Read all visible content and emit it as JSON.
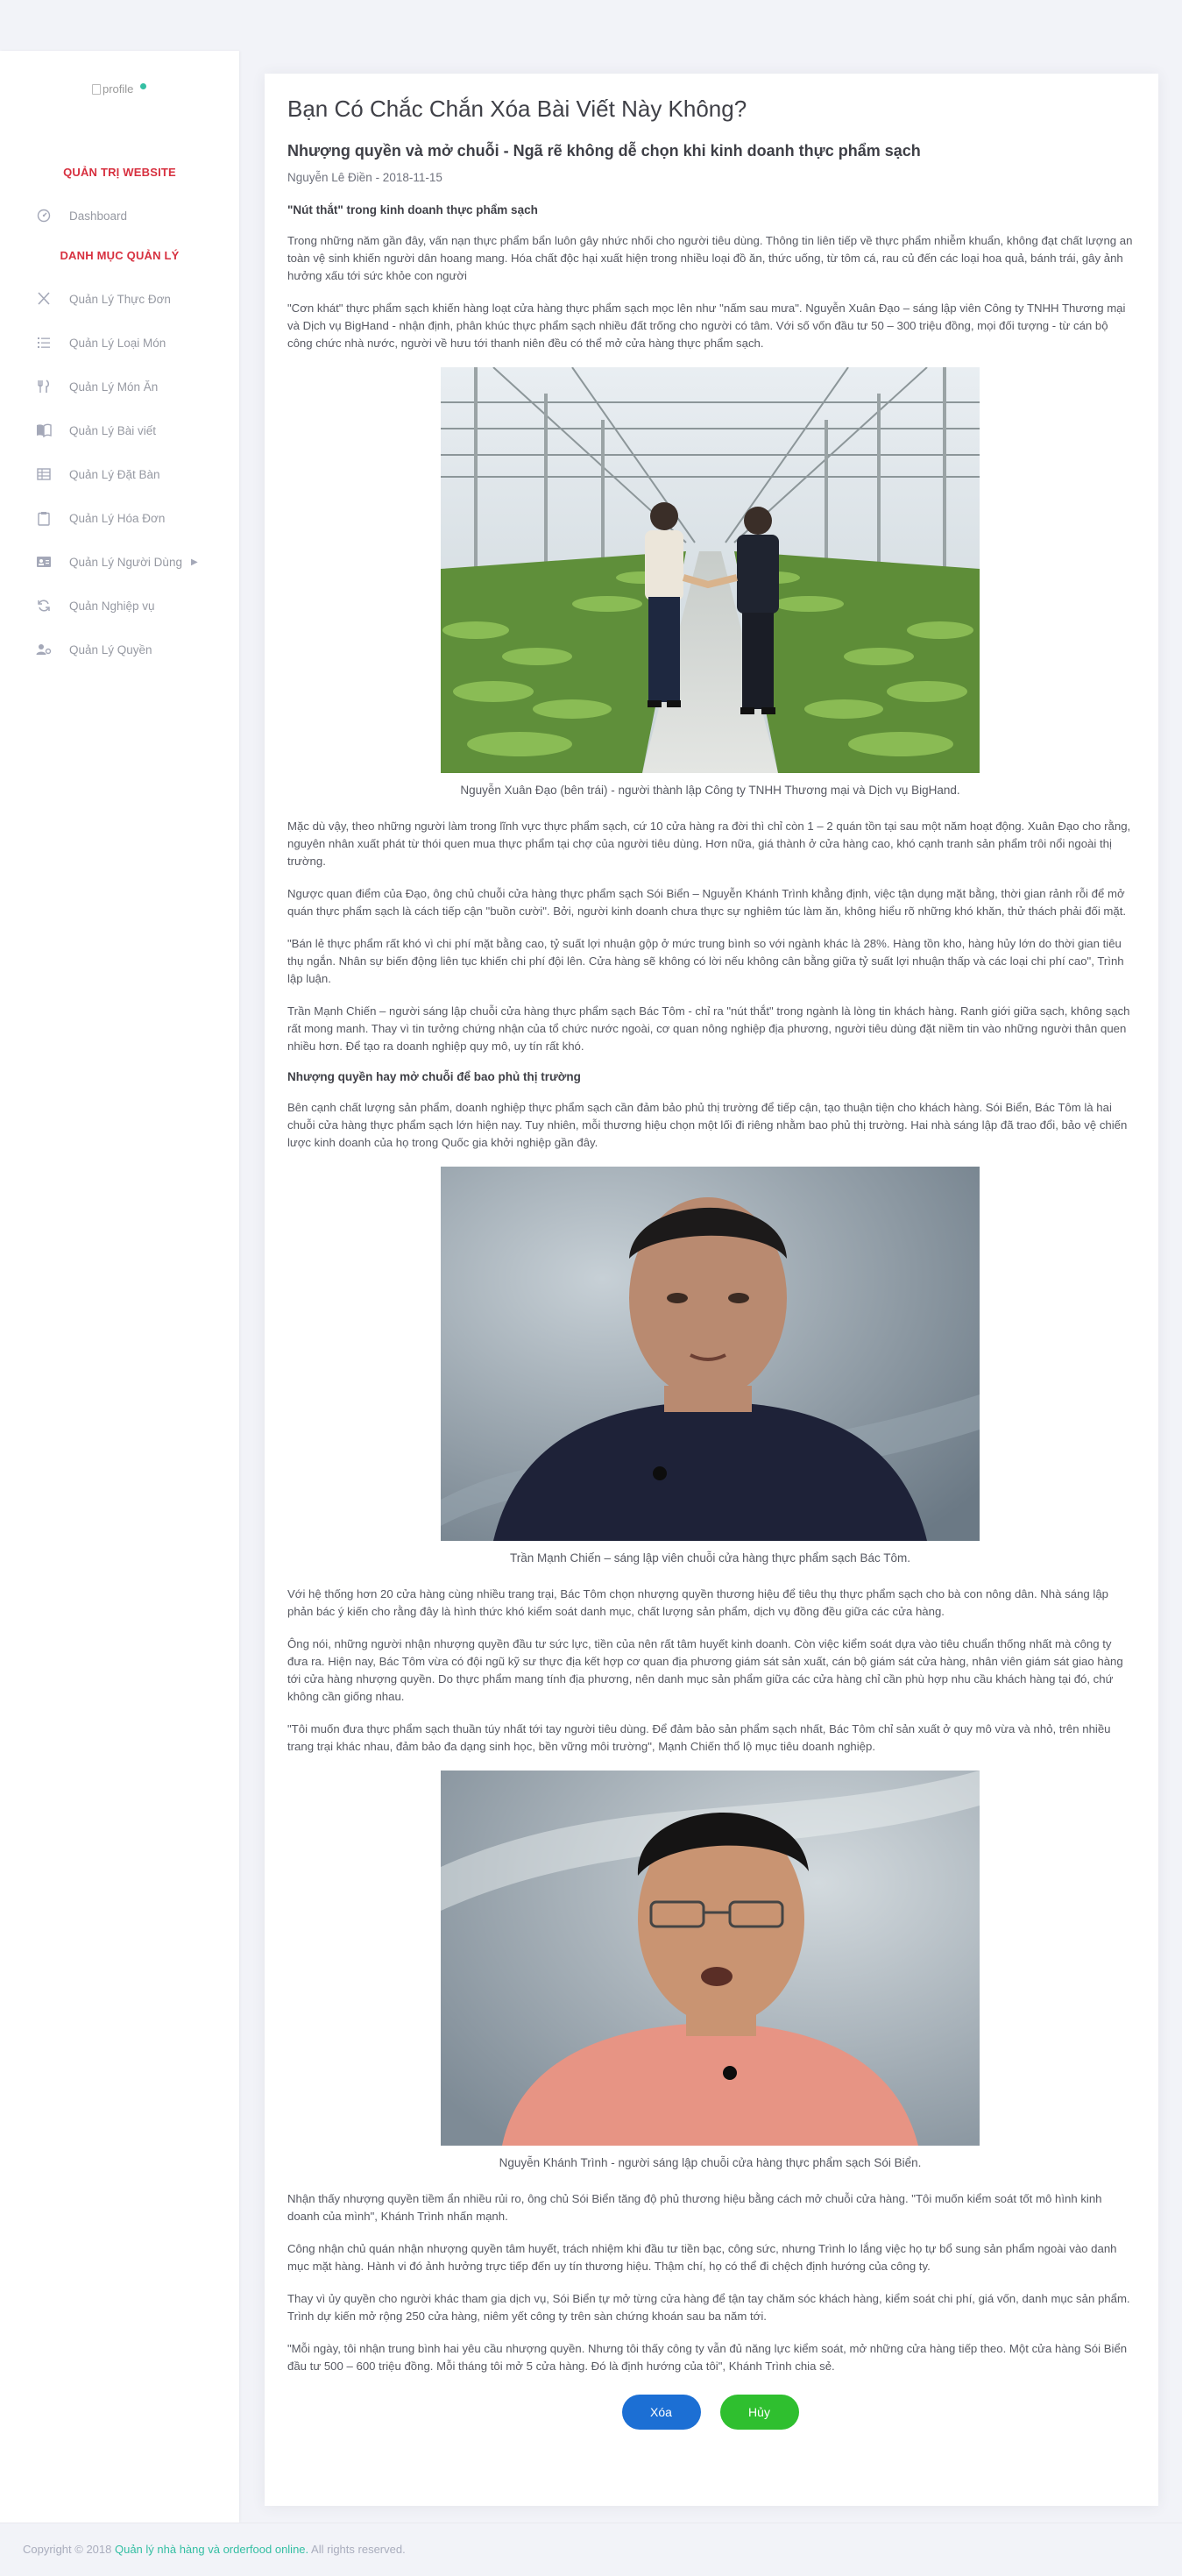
{
  "sidebar": {
    "avatar_alt": "profile",
    "section_admin": "QUẢN TRỊ WEBSITE",
    "dashboard": "Dashboard",
    "section_manage": "DANH MỤC QUẢN LÝ",
    "items": [
      {
        "label": "Quản Lý Thực Đơn",
        "icon": "utensils-icon"
      },
      {
        "label": "Quản Lý Loại Món",
        "icon": "list-icon"
      },
      {
        "label": "Quản Lý Món Ăn",
        "icon": "dish-icon"
      },
      {
        "label": "Quản Lý Bài viết",
        "icon": "book-icon"
      },
      {
        "label": "Quản Lý Đặt Bàn",
        "icon": "table-icon"
      },
      {
        "label": "Quản Lý Hóa Đơn",
        "icon": "clipboard-icon"
      },
      {
        "label": "Quản Lý Người Dùng",
        "icon": "id-card-icon"
      },
      {
        "label": "Quản Nghiệp vụ",
        "icon": "refresh-icon"
      },
      {
        "label": "Quản Lý Quyền",
        "icon": "user-cog-icon"
      }
    ]
  },
  "main": {
    "page_title": "Bạn Có Chắc Chắn Xóa Bài Viết Này Không?",
    "post_title": "Nhượng quyền và mở chuỗi - Ngã rẽ không dễ chọn khi kinh doanh thực phẩm sạch",
    "meta": "Nguyễn Lê Điền - 2018-11-15",
    "subhead1": "\"Nút thắt\" trong kinh doanh thực phẩm sạch",
    "p1": "Trong những năm gần đây, vấn nạn thực phẩm bẩn luôn gây nhức nhối cho người tiêu dùng. Thông tin liên tiếp về thực phẩm nhiễm khuẩn, không đạt chất lượng an toàn vệ sinh khiến người dân hoang mang. Hóa chất độc hại xuất hiện trong nhiều loại đồ ăn, thức uống, từ tôm cá, rau củ đến các loại hoa quả, bánh trái, gây ảnh hưởng xấu tới sức khỏe con người",
    "p2": "\"Cơn khát\" thực phẩm sạch khiến hàng loạt cửa hàng thực phẩm sạch mọc lên như \"nấm sau mưa\". Nguyễn Xuân Đạo – sáng lập viên Công ty TNHH Thương mại và Dịch vụ BigHand - nhận định, phân khúc thực phẩm sạch nhiều đất trống cho người có tâm. Với số vốn đầu tư 50 – 300 triệu đồng, mọi đối tượng - từ cán bộ công chức nhà nước, người về hưu tới thanh niên đều có thể mở cửa hàng thực phẩm sạch.",
    "caption1": "Nguyễn Xuân Đạo (bên trái) - người thành lập Công ty TNHH Thương mại và Dịch vụ BigHand.",
    "p3": "Mặc dù vậy, theo những người làm trong lĩnh vực thực phẩm sạch, cứ 10 cửa hàng ra đời thì chỉ còn 1 – 2 quán tồn tại sau một năm hoạt động. Xuân Đạo cho rằng, nguyên nhân xuất phát từ thói quen mua thực phẩm tại chợ của người tiêu dùng. Hơn nữa, giá thành ở cửa hàng cao, khó cạnh tranh sản phẩm trôi nổi ngoài thị trường.",
    "p4": "Ngược quan điểm của Đạo, ông chủ chuỗi cửa hàng thực phẩm sạch Sói Biển – Nguyễn Khánh Trình khẳng định, việc tận dụng mặt bằng, thời gian rảnh rỗi để mở quán thực phẩm sạch là cách tiếp cận \"buồn cười\". Bởi, người kinh doanh chưa thực sự nghiêm túc làm ăn, không hiểu rõ những khó khăn, thử thách phải đối mặt.",
    "p5": "\"Bán lẻ thực phẩm rất khó vì chi phí mặt bằng cao, tỷ suất lợi nhuận gộp ở mức trung bình so với ngành khác là 28%. Hàng tồn kho, hàng hủy lớn do thời gian tiêu thụ ngắn. Nhân sự biến động liên tục khiến chi phí đội lên. Cửa hàng sẽ không có lời nếu không cân bằng giữa tỷ suất lợi nhuận thấp và các loại chi phí cao\", Trình lập luận.",
    "p6": "Trần Mạnh Chiến – người sáng lập chuỗi cửa hàng thực phẩm sạch Bác Tôm - chỉ ra \"nút thắt\" trong ngành là lòng tin khách hàng. Ranh giới giữa sạch, không sạch rất mong manh. Thay vì tin tưởng chứng nhận của tổ chức nước ngoài, cơ quan nông nghiệp địa phương, người tiêu dùng đặt niềm tin vào những người thân quen nhiều hơn. Để tạo ra doanh nghiệp quy mô, uy tín rất khó.",
    "subhead2": "Nhượng quyền hay mở chuỗi để bao phủ thị trường",
    "p7": "Bên cạnh chất lượng sản phẩm, doanh nghiệp thực phẩm sạch cần đảm bảo phủ thị trường để tiếp cận, tạo thuận tiện cho khách hàng. Sói Biển, Bác Tôm là hai chuỗi cửa hàng thực phẩm sạch lớn hiện nay. Tuy nhiên, mỗi thương hiệu chọn một lối đi riêng nhằm bao phủ thị trường. Hai nhà sáng lập đã trao đổi, bảo vệ chiến lược kinh doanh của họ trong Quốc gia khởi nghiệp gần đây.",
    "caption2": "Trần Mạnh Chiến – sáng lập viên chuỗi cửa hàng thực phẩm sạch Bác Tôm.",
    "p8": "Với hệ thống hơn 20 cửa hàng cùng nhiều trang trại, Bác Tôm chọn nhượng quyền thương hiệu để tiêu thụ thực phẩm sạch cho bà con nông dân. Nhà sáng lập phản bác ý kiến cho rằng đây là hình thức khó kiểm soát danh mục, chất lượng sản phẩm, dịch vụ đồng đều giữa các cửa hàng.",
    "p9": "Ông nói, những người nhận nhượng quyền đầu tư sức lực, tiền của nên rất tâm huyết kinh doanh. Còn việc kiểm soát dựa vào tiêu chuẩn thống nhất mà công ty đưa ra. Hiện nay, Bác Tôm vừa có đội ngũ kỹ sư thực địa kết hợp cơ quan địa phương giám sát sản xuất, cán bộ giám sát cửa hàng, nhân viên giám sát giao hàng tới cửa hàng nhượng quyền. Do thực phẩm mang tính địa phương, nên danh mục sản phẩm giữa các cửa hàng chỉ cần phù hợp nhu cầu khách hàng tại đó, chứ không cần giống nhau.",
    "p10": "\"Tôi muốn đưa thực phẩm sạch thuần túy nhất tới tay người tiêu dùng. Để đảm bảo sản phẩm sạch nhất, Bác Tôm chỉ sản xuất ở quy mô vừa và nhỏ, trên nhiều trang trại khác nhau, đảm bảo đa dạng sinh học, bền vững môi trường\", Mạnh Chiến thổ lộ mục tiêu doanh nghiệp.",
    "caption3": "Nguyễn Khánh Trình - người sáng lập chuỗi cửa hàng thực phẩm sạch Sói Biển.",
    "p11": "Nhận thấy nhượng quyền tiềm ẩn nhiều rủi ro, ông chủ Sói Biển tăng độ phủ thương hiệu bằng cách mở chuỗi cửa hàng. \"Tôi muốn kiểm soát tốt mô hình kinh doanh của mình\", Khánh Trình nhấn mạnh.",
    "p12": "Công nhận chủ quán nhận nhượng quyền tâm huyết, trách nhiệm khi đầu tư tiền bạc, công sức, nhưng Trình lo lắng việc họ tự bổ sung sản phẩm ngoài vào danh mục mặt hàng. Hành vi đó ảnh hưởng trực tiếp đến uy tín thương hiệu. Thậm chí, họ có thể đi chệch định hướng của công ty.",
    "p13": "Thay vì ủy quyền cho người khác tham gia dịch vụ, Sói Biển tự mở từng cửa hàng để tận tay chăm sóc khách hàng, kiểm soát chi phí, giá vốn, danh mục sản phẩm. Trình dự kiến mở rộng 250 cửa hàng, niêm yết công ty trên sàn chứng khoán sau ba năm tới.",
    "p14": "\"Mỗi ngày, tôi nhận trung bình hai yêu cầu nhượng quyền. Nhưng tôi thấy công ty vẫn đủ năng lực kiểm soát, mở những cửa hàng tiếp theo. Một cửa hàng Sói Biển đầu tư 500 – 600 triệu đồng. Mỗi tháng tôi mở 5 cửa hàng. Đó là định hướng của tôi\", Khánh Trình chia sẻ.",
    "delete_label": "Xóa",
    "cancel_label": "Hủy"
  },
  "footer": {
    "prefix": "Copyright © 2018 ",
    "brand": "Quản lý nhà hàng và orderfood online.",
    "suffix": " All rights reserved."
  },
  "colors": {
    "section_title": "#d7303f",
    "delete_button": "#1c6fd4",
    "cancel_button": "#2fbf2f",
    "footer_brand": "#34bfa3"
  }
}
